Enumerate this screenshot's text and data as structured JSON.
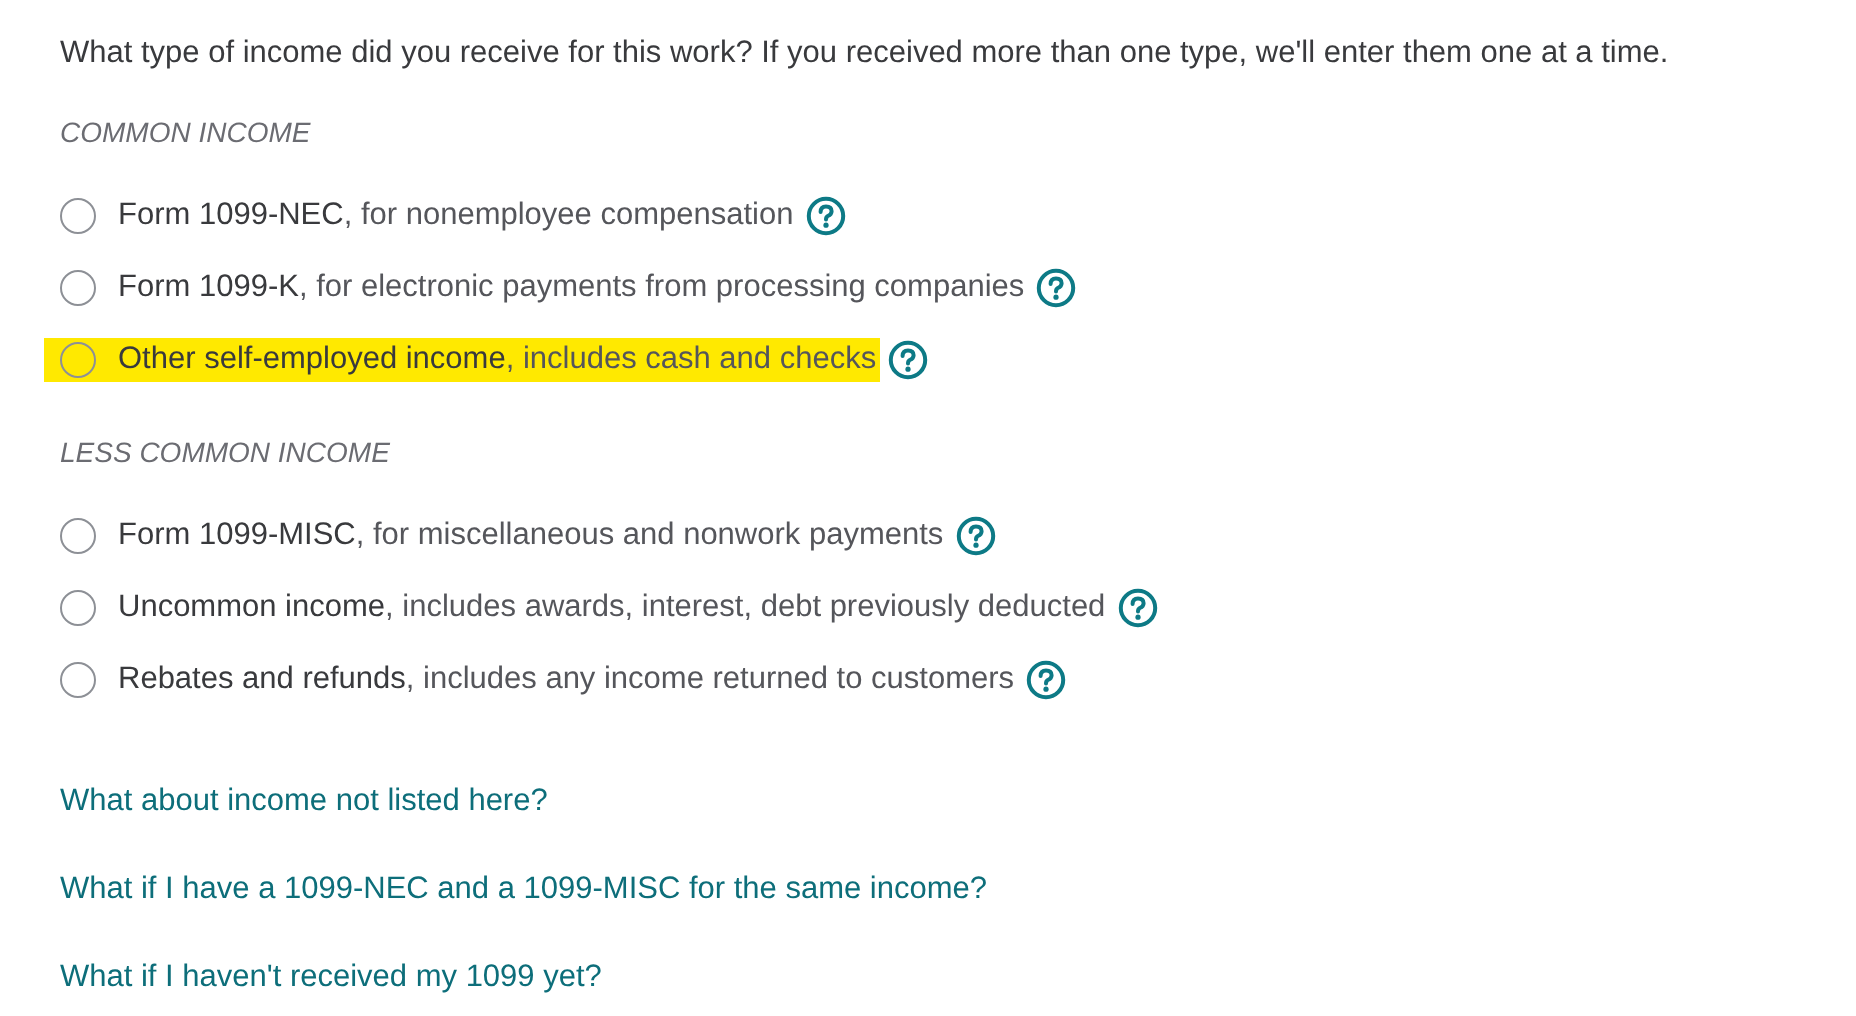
{
  "question": "What type of income did you receive for this work? If you received more than one type, we'll enter them one at a time.",
  "sections": [
    {
      "heading": "COMMON INCOME",
      "options": [
        {
          "title": "Form 1099-NEC",
          "detail": ", for nonemployee compensation",
          "selected": false,
          "highlighted": false
        },
        {
          "title": "Form 1099-K",
          "detail": ", for electronic payments from processing companies",
          "selected": false,
          "highlighted": false
        },
        {
          "title": "Other self-employed income",
          "detail": ", includes cash and checks",
          "selected": false,
          "highlighted": true
        }
      ]
    },
    {
      "heading": "LESS COMMON INCOME",
      "options": [
        {
          "title": "Form 1099-MISC",
          "detail": ", for miscellaneous and nonwork payments",
          "selected": false,
          "highlighted": false
        },
        {
          "title": "Uncommon income",
          "detail": ", includes awards, interest, debt previously deducted",
          "selected": false,
          "highlighted": false
        },
        {
          "title": "Rebates and refunds",
          "detail": ", includes any income returned to customers",
          "selected": false,
          "highlighted": false
        }
      ]
    }
  ],
  "links": [
    "What about income not listed here?",
    "What if I have a 1099-NEC and a 1099-MISC for the same income?",
    "What if I haven't received my 1099 yet?"
  ]
}
